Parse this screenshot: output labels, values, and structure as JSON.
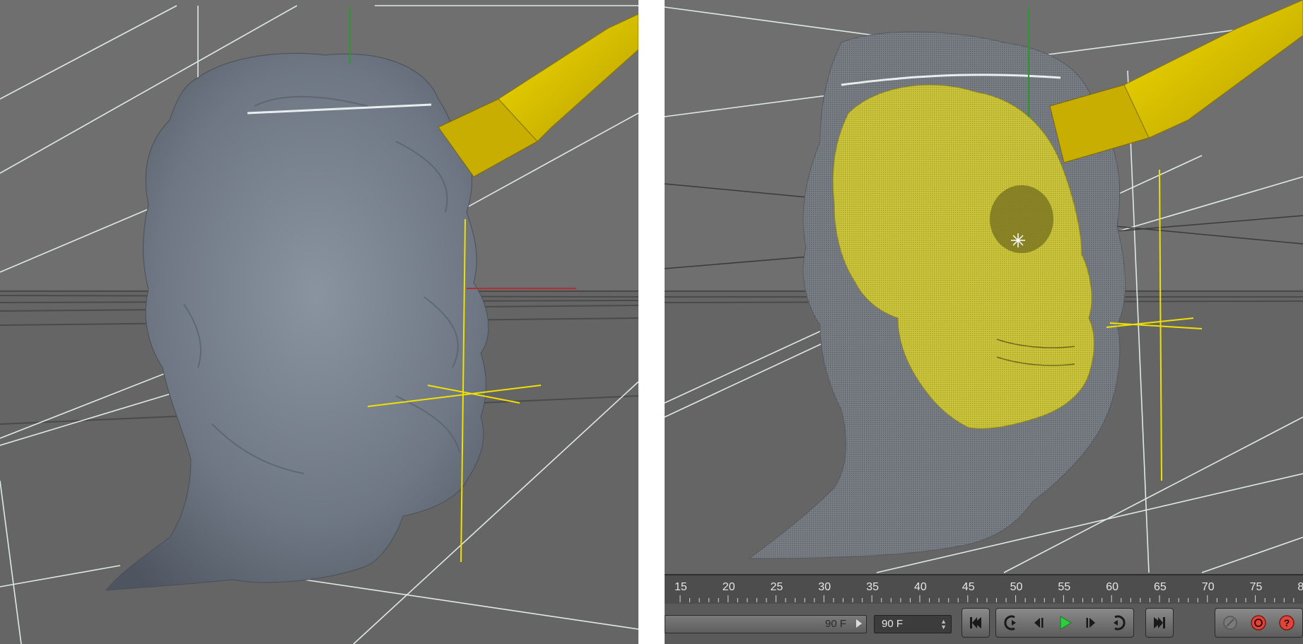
{
  "left_viewport": {
    "name": "viewport-left"
  },
  "right_viewport": {
    "name": "viewport-right"
  },
  "timeline": {
    "ruler_labels": [
      "15",
      "20",
      "25",
      "30",
      "35",
      "40",
      "45",
      "50",
      "55",
      "60",
      "65",
      "70",
      "75",
      "8"
    ],
    "end_frame_slider": "90 F",
    "end_frame_field": "90 F",
    "buttons": [
      {
        "name": "goto-start-button",
        "icon": "skip-to-start-icon"
      },
      {
        "name": "prev-key-button",
        "icon": "previous-keyframe-icon"
      },
      {
        "name": "step-back-button",
        "icon": "step-back-icon"
      },
      {
        "name": "play-button",
        "icon": "play-icon"
      },
      {
        "name": "step-forward-button",
        "icon": "step-forward-icon"
      },
      {
        "name": "next-key-button",
        "icon": "next-keyframe-icon"
      },
      {
        "name": "goto-end-button",
        "icon": "skip-to-end-icon"
      },
      {
        "name": "record-key-button",
        "icon": "key-icon"
      },
      {
        "name": "autokey-button",
        "icon": "autokey-icon"
      },
      {
        "name": "help-button",
        "icon": "question-icon"
      }
    ]
  },
  "colors": {
    "viewport_bg": "#6e6e6e",
    "head_mesh": "#6f7782",
    "knife_yellow": "#e0c400",
    "skull_yellow": "#c9c23a",
    "play_green": "#2ecc40",
    "record_red": "#e0453a"
  }
}
